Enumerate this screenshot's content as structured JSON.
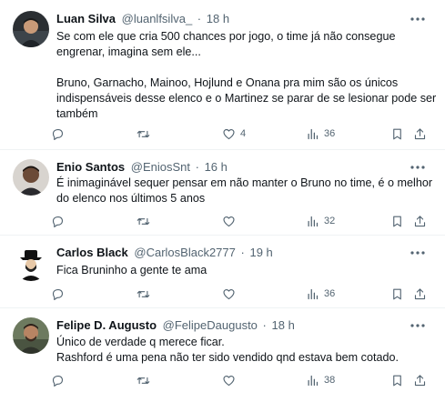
{
  "tweets": [
    {
      "name": "Luan Silva",
      "handle": "@luanlfsilva_",
      "separator": "·",
      "time": "18 h",
      "lines": [
        "Se com ele que cria 500 chances por jogo, o time já não consegue",
        "engrenar, imagina sem ele...",
        "",
        "Bruno, Garnacho, Mainoo, Hojlund e Onana pra mim são os únicos",
        "indispensáveis desse elenco e o Martinez se parar de se lesionar pode ser",
        "também"
      ],
      "likes": "4",
      "views": "36"
    },
    {
      "name": "Enio Santos",
      "handle": "@EniosSnt",
      "separator": "·",
      "time": "16 h",
      "lines": [
        "É inimaginável sequer pensar em não manter o Bruno no time, é o melhor",
        "do elenco nos últimos 5 anos"
      ],
      "likes": "",
      "views": "32"
    },
    {
      "name": "Carlos Black",
      "handle": "@CarlosBlack2777",
      "separator": "·",
      "time": "19 h",
      "lines": [
        "Fica Bruninho a gente te ama"
      ],
      "likes": "",
      "views": "36"
    },
    {
      "name": "Felipe D. Augusto",
      "handle": "@FelipeDaugusto",
      "separator": "·",
      "time": "18 h",
      "lines": [
        "Único de verdade q merece ficar.",
        "Rashford é uma pena não ter sido vendido qnd estava bem cotado."
      ],
      "likes": "",
      "views": "38"
    }
  ],
  "icons": {
    "more": "more-horizontal-icon",
    "reply": "reply-icon",
    "retweet": "retweet-icon",
    "like": "heart-icon",
    "views": "views-chart-icon",
    "bookmark": "bookmark-icon",
    "share": "share-icon"
  },
  "colors": {
    "text": "#0f1419",
    "secondary": "#536471",
    "divider": "#eff3f4"
  }
}
